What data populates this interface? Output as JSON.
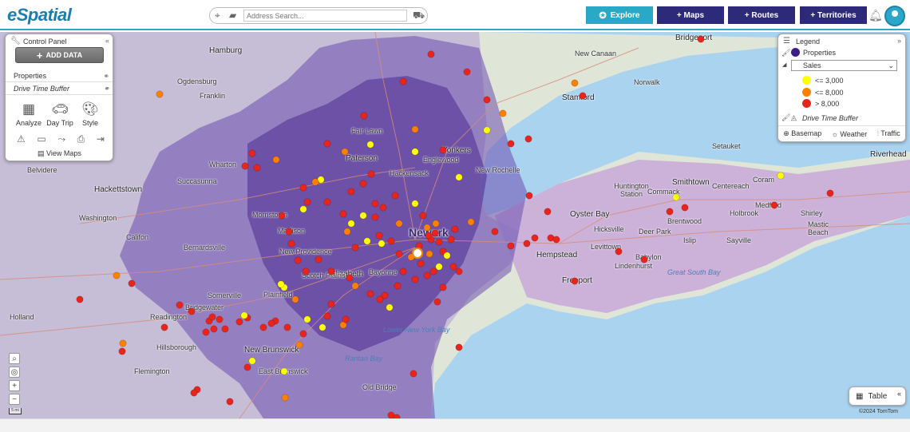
{
  "app": {
    "logo": "eSpatial"
  },
  "search": {
    "placeholder": "Address Search..."
  },
  "nav": {
    "explore": "Explore",
    "maps": "+ Maps",
    "routes": "+ Routes",
    "territories": "+ Territories"
  },
  "colors": {
    "explore_btn": "#29a9c5",
    "nav_btn": "#2d2a7a",
    "buffer": "#5b3fa0",
    "sales_low": "#ffff00",
    "sales_mid": "#ff7f00",
    "sales_high": "#e8251c",
    "water": "#aad3f0",
    "land": "#dfe6d8"
  },
  "control_panel": {
    "title": "Control Panel",
    "add_data": "ADD DATA",
    "layers": [
      "Properties",
      "Drive Time Buffer"
    ],
    "tools": [
      "Analyze",
      "Day Trip",
      "Style"
    ],
    "view_maps": "View Maps"
  },
  "legend": {
    "title": "Legend",
    "layer": "Properties",
    "select_value": "Sales",
    "ranges": [
      "<= 3,000",
      "<= 8,000",
      "> 8,000"
    ],
    "buffer_layer": "Drive Time Buffer",
    "footer": [
      "Basemap",
      "Weather",
      "Traffic"
    ]
  },
  "map": {
    "labels": [
      "Hamburg",
      "Ogdensburg",
      "Franklin",
      "Wharton",
      "Succasunna",
      "Hackettstown",
      "Belvidere",
      "Washington",
      "Califon",
      "Bernardsville",
      "Bridgewater",
      "Readington",
      "Hillsborough",
      "Holland",
      "Paterson",
      "Fair Lawn",
      "Hackensack",
      "Englewood",
      "Yonkers",
      "New Rochelle",
      "Stamford",
      "Norwalk",
      "New Canaan",
      "Bridgeport",
      "Newark",
      "Elizabeth",
      "Bayonne",
      "Plainfield",
      "Somerville",
      "New Brunswick",
      "East Brunswick",
      "Old Bridge",
      "Huntington Station",
      "Commack",
      "Smithtown",
      "Oyster Bay",
      "Hicksville",
      "Deer Park",
      "Brentwood",
      "Islip",
      "Sayville",
      "Holbrook",
      "Medford",
      "Coram",
      "Shirley",
      "Mastic Beach",
      "Riverhead",
      "Setauket",
      "Centereach",
      "Hempstead",
      "Levittown",
      "Freeport",
      "Babylon",
      "Lindenhurst",
      "Great South Bay",
      "Lower New York Bay",
      "Raritan Bay",
      "Flemington",
      "Scotch Plains",
      "Morristown",
      "Madison",
      "New Providence"
    ],
    "scale": "5 mi",
    "copyright": "©2024 TomTom"
  },
  "table_button": "Table"
}
